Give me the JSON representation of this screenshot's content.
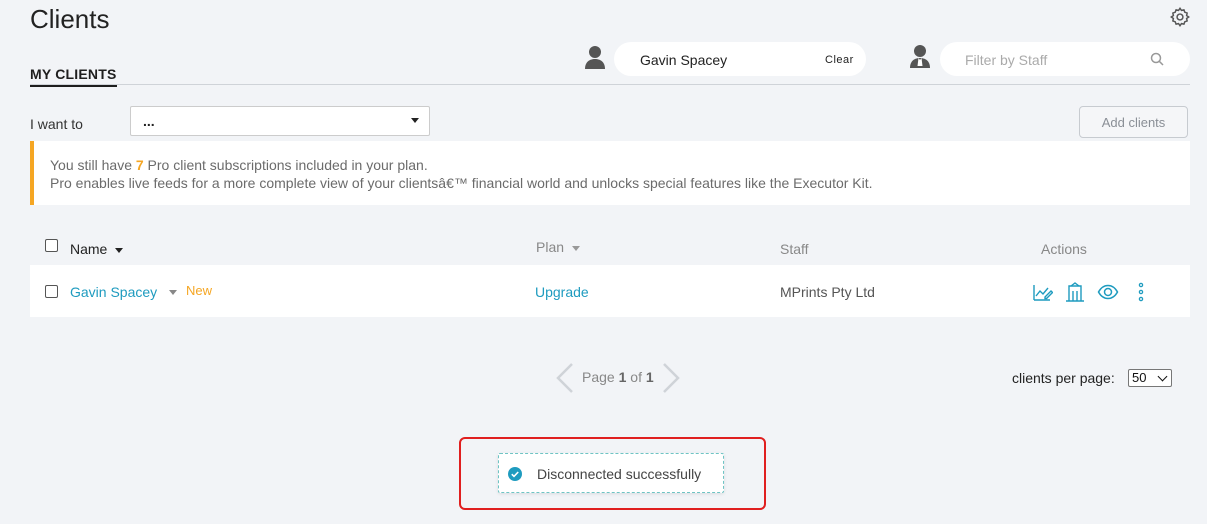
{
  "page": {
    "title": "Clients"
  },
  "tabs": {
    "my_clients": "MY CLIENTS"
  },
  "client_filter": {
    "value": "Gavin Spacey",
    "clear_label": "Clear"
  },
  "staff_filter": {
    "placeholder": "Filter by Staff"
  },
  "action_bar": {
    "label": "I want to",
    "selected": "...",
    "add_button": "Add clients"
  },
  "banner": {
    "line1_prefix": "You still have ",
    "count": "7",
    "line1_suffix": " Pro client subscriptions included in your plan.",
    "line2": "Pro enables live feeds for a more complete view of your clientsâ€™ financial world and unlocks special features like the Executor Kit."
  },
  "table": {
    "columns": {
      "name": "Name",
      "plan": "Plan",
      "staff": "Staff",
      "actions": "Actions"
    },
    "rows": [
      {
        "name": "Gavin Spacey",
        "badge": "New",
        "plan": "Upgrade",
        "staff": "MPrints Pty Ltd"
      }
    ]
  },
  "pagination": {
    "prefix": "Page ",
    "current": "1",
    "sep": " of ",
    "total": "1"
  },
  "per_page": {
    "label": "clients per page:",
    "value": "50"
  },
  "toast": {
    "message": "Disconnected successfully"
  },
  "colors": {
    "accent": "#1e9bbf",
    "warning": "#f5a623",
    "highlight": "#e01f1f"
  },
  "icons": [
    "gear-icon",
    "person-icon",
    "staff-person-icon",
    "search-icon",
    "edit-chart-icon",
    "building-icon",
    "eye-icon",
    "more-vertical-icon",
    "check-circle-icon"
  ]
}
